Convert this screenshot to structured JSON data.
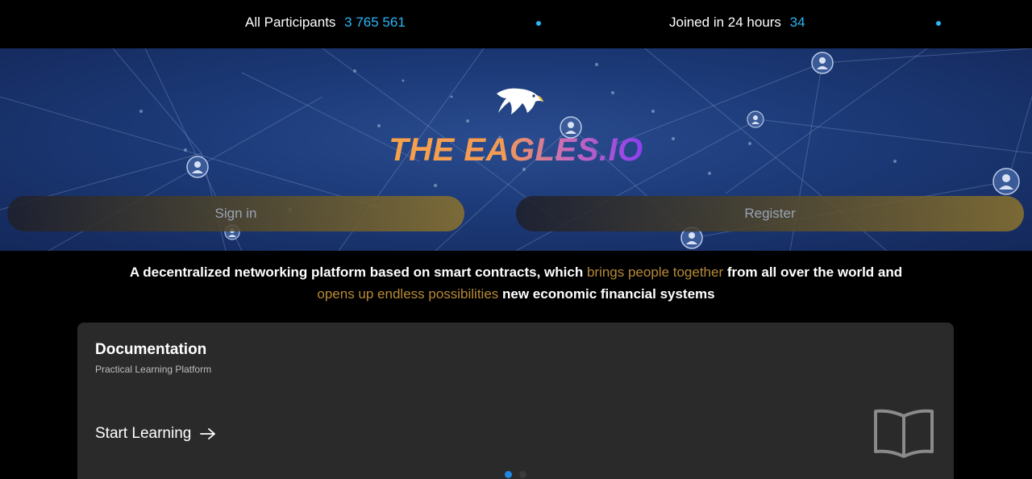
{
  "stats": {
    "participants_label": "All Participants",
    "participants_value": "3 765 561",
    "joined_label": "Joined in 24 hours",
    "joined_value": "34"
  },
  "hero": {
    "brand": "THE EAGLES.IO",
    "sign_in_label": "Sign in",
    "register_label": "Register"
  },
  "tagline": {
    "part1": "A decentralized networking platform based on smart contracts, which ",
    "highlight1": "brings people together",
    "part2": " from all over the world and",
    "highlight2": "opens up endless possibilities",
    "part3": " new economic financial systems"
  },
  "documentation": {
    "title": "Documentation",
    "subtitle": "Practical Learning Platform",
    "cta": "Start Learning"
  },
  "colors": {
    "accent_blue": "#29b6f6",
    "highlight_gold": "#b78a35",
    "hero_blue": "#1c3a78"
  },
  "icons": {
    "logo": "eagle-logo-icon",
    "cta_arrow": "arrow-right-icon",
    "book": "open-book-icon",
    "node": "user-node-icon"
  }
}
